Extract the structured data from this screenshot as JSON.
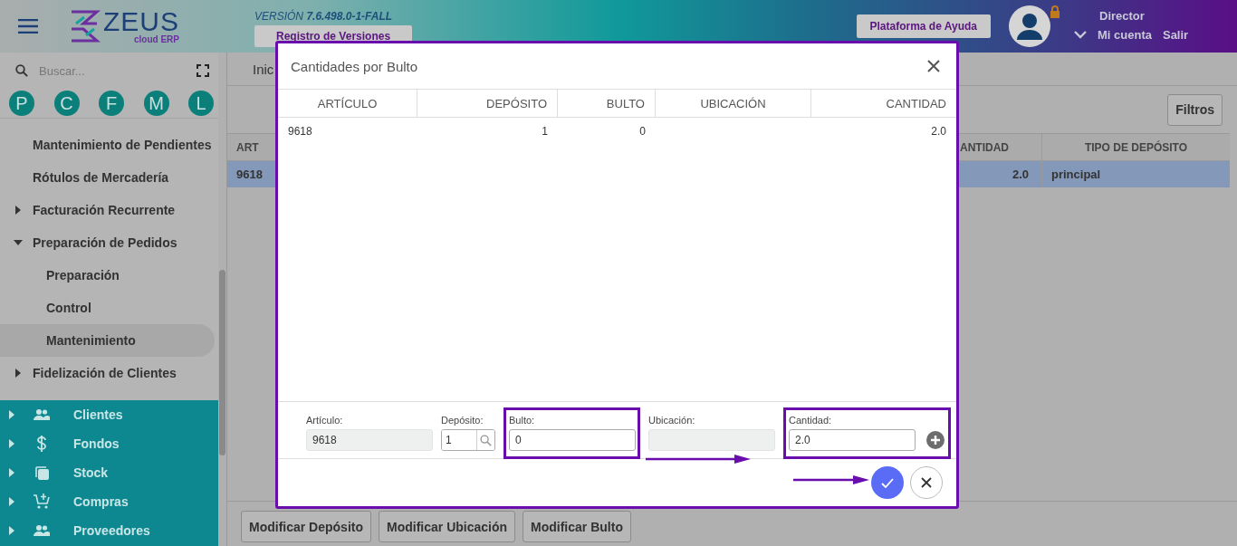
{
  "header": {
    "logo": {
      "name": "ZEUS",
      "subtitle": "cloud ERP"
    },
    "version_label": "VERSIÓN",
    "version": "7.6.498.0-1-FALL",
    "release_notes_button": "Registro de Versiones",
    "help_button": "Plataforma de Ayuda",
    "user": {
      "name": "Director",
      "links": [
        "Mi cuenta",
        "Salir"
      ]
    }
  },
  "sidebar": {
    "search": {
      "placeholder": "Buscar..."
    },
    "shortcuts": [
      "P",
      "C",
      "F",
      "M",
      "L"
    ],
    "items": [
      {
        "label": "Mantenimiento de Pendientes",
        "selected": false
      },
      {
        "label": "Rótulos de Mercadería",
        "selected": false
      },
      {
        "label": "Facturación Recurrente",
        "selected": false,
        "expanded": false
      },
      {
        "label": "Preparación de Pedidos",
        "selected": false,
        "expanded": true,
        "children": [
          {
            "label": "Preparación",
            "selected": false
          },
          {
            "label": "Control",
            "selected": false
          },
          {
            "label": "Mantenimiento",
            "selected": true
          }
        ]
      },
      {
        "label": "Fidelización de Clientes",
        "selected": false,
        "expanded": false
      }
    ],
    "modules": [
      {
        "label": "Clientes",
        "kind": "people",
        "expanded": false
      },
      {
        "label": "Fondos",
        "kind": "money",
        "expanded": false
      },
      {
        "label": "Stock",
        "kind": "box",
        "expanded": false
      },
      {
        "label": "Compras",
        "kind": "cart",
        "expanded": false
      },
      {
        "label": "Proveedores",
        "kind": "people",
        "expanded": false
      }
    ]
  },
  "main": {
    "tab": "Inic",
    "filter_button": "Filtros",
    "table": {
      "columns": [
        "ART",
        "ANTIDAD",
        "TIPO DE DEPÓSITO"
      ],
      "rows": [
        {
          "cells": [
            "9618",
            "2.0",
            "principal"
          ],
          "selected": true
        }
      ]
    },
    "buttons": [
      "Modificar Depósito",
      "Modificar Ubicación",
      "Modificar Bulto"
    ]
  },
  "modal": {
    "title": "Cantidades por Bulto",
    "columns": [
      "ARTÍCULO",
      "DEPÓSITO",
      "BULTO",
      "UBICACIÓN",
      "CANTIDAD"
    ],
    "rows": [
      {
        "cells": [
          "9618",
          "1",
          "0",
          null,
          "2.0"
        ]
      }
    ],
    "fields": [
      {
        "label": "Artículo:",
        "value": "9618",
        "kind": "text",
        "disabled": true,
        "highlighted": false
      },
      {
        "label": "Depósito:",
        "value": "1",
        "kind": "lookup",
        "disabled": false,
        "highlighted": false
      },
      {
        "label": "Bulto:",
        "value": "0",
        "kind": "text",
        "disabled": false,
        "highlighted": true
      },
      {
        "label": "Ubicación:",
        "kind": "text",
        "disabled": true,
        "highlighted": false
      },
      {
        "label": "Cantidad:",
        "value": "2.0",
        "kind": "text",
        "disabled": false,
        "highlighted": true
      }
    ]
  }
}
